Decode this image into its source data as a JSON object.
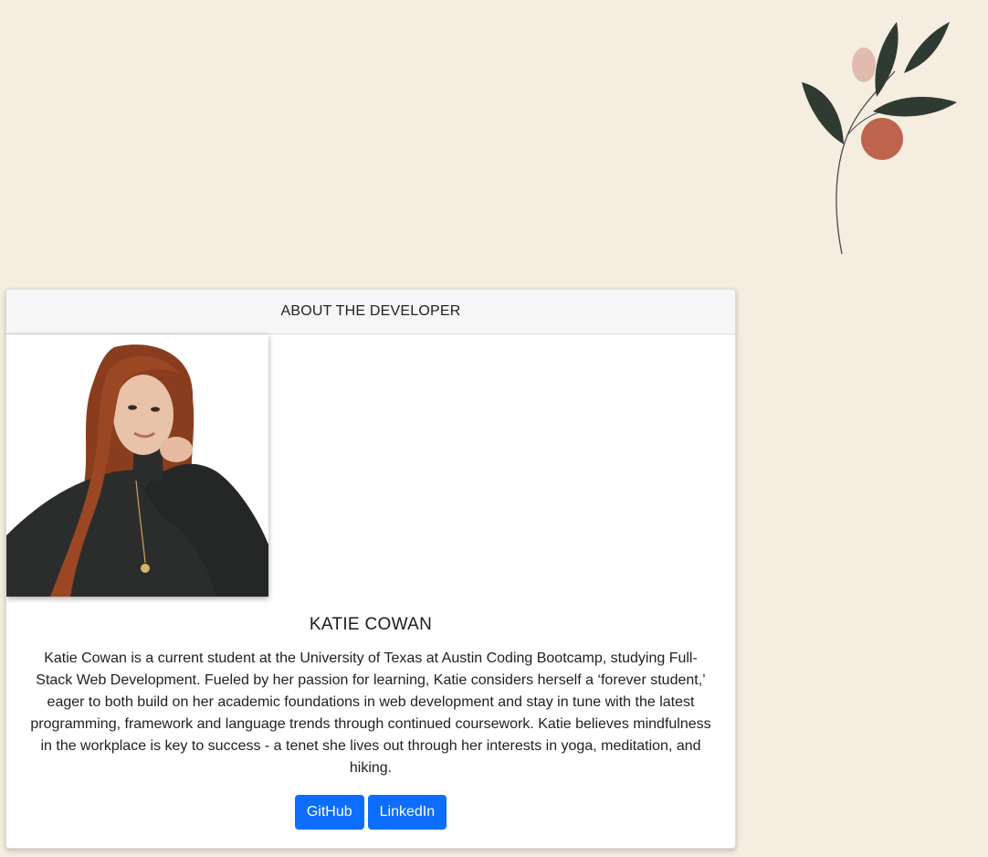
{
  "card": {
    "header": "ABOUT THE DEVELOPER",
    "name": "KATIE COWAN",
    "bio": "Katie Cowan is a current student at the University of Texas at Austin Coding Bootcamp, studying Full-Stack Web Development. Fueled by her passion for learning, Katie considers herself a ‘forever student,’ eager to both build on her academic foundations in web development and stay in tune with the latest programming, framework and language trends through continued coursework. Katie believes mindfulness in the workplace is key to success - a tenet she lives out through her interests in yoga, meditation, and hiking.",
    "buttons": {
      "github": "GitHub",
      "linkedin": "LinkedIn"
    }
  },
  "colors": {
    "background": "#f5ede0",
    "button": "#0d6efd",
    "leaf": "#2f3a33",
    "berry": "#b8583f",
    "berry_light": "#dcb1a4"
  },
  "icons": {
    "decoration": "branch-with-leaves-illustration",
    "photo": "developer-portrait-photo"
  }
}
